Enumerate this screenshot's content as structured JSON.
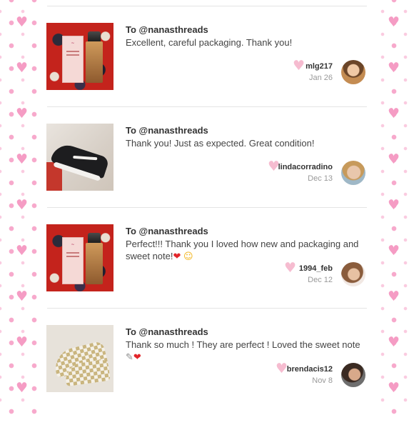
{
  "reviews": [
    {
      "recipient": "To @nanasthreads",
      "message": "Excellent, careful packaging. Thank you!",
      "emojis": [],
      "username": "mlg217",
      "date": "Jan 26",
      "image": "makeup-box-and-foundation-bottle",
      "like_icon": "heart-icon"
    },
    {
      "recipient": "To @nanasthreads",
      "message": "Thank you! Just as expected. Great condition!",
      "emojis": [],
      "username": "lindacorradino",
      "date": "Dec 13",
      "image": "black-sneaker-held-in-hand",
      "like_icon": "heart-icon"
    },
    {
      "recipient": "To @nanasthreads",
      "message": "Perfect!!! Thank you I loved how new and packaging and sweet note!",
      "emojis": [
        "❤",
        "☺"
      ],
      "username": "1994_feb",
      "date": "Dec 12",
      "image": "makeup-box-and-foundation-bottle",
      "like_icon": "heart-icon"
    },
    {
      "recipient": "To @nanasthreads",
      "message": "Thank so much ! They are perfect ! Loved the sweet note",
      "emojis": [
        "✎",
        "❤"
      ],
      "username": "brendacis12",
      "date": "Nov 8",
      "image": "checkered-slip-on-sneakers",
      "like_icon": "heart-icon"
    }
  ],
  "decor": {
    "heart_glyph": "♥",
    "side_hearts_color": "#f59cc4",
    "like_heart_color": "#f6bcd0",
    "emoji_heart_color": "#e2262b"
  }
}
